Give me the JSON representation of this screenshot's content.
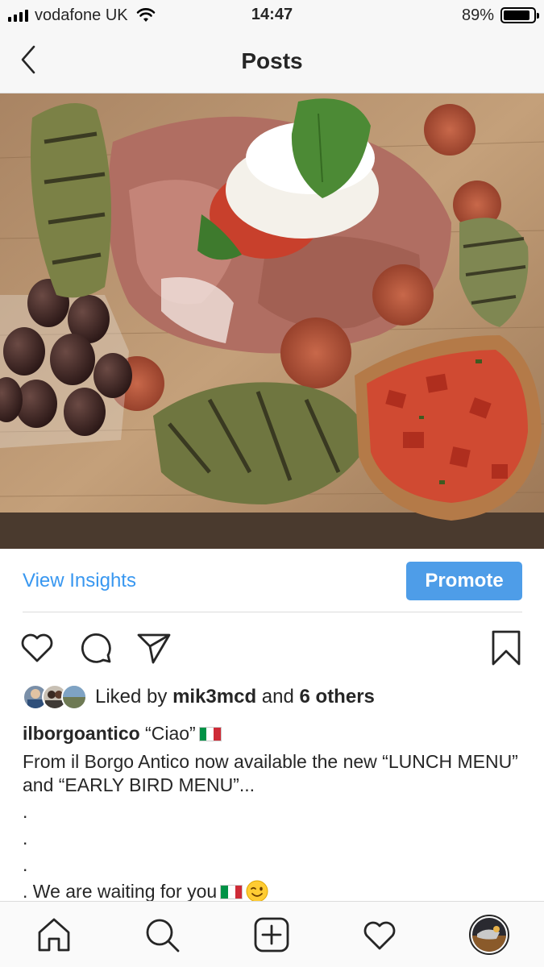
{
  "status_bar": {
    "carrier": "vodafone UK",
    "time": "14:47",
    "battery_percent": "89%",
    "battery_level": 0.89
  },
  "header": {
    "title": "Posts",
    "back_icon": "chevron-left-icon"
  },
  "photo": {
    "icon": "food-platter-photo"
  },
  "insights": {
    "view_insights_label": "View Insights",
    "promote_label": "Promote"
  },
  "actions": {
    "icons": [
      "heart-icon",
      "comment-icon",
      "share-icon",
      "bookmark-icon"
    ]
  },
  "likes": {
    "prefix": "Liked by ",
    "user": "mik3mcd",
    "middle": " and ",
    "others": "6 others"
  },
  "caption": {
    "username": "ilborgoantico",
    "title": " “Ciao”",
    "body": "From il Borgo Antico now available the new “LUNCH MENU” and “EARLY BIRD MENU”...",
    "dot1": ".",
    "dot2": ".",
    "dot3": ".",
    "closing": ". We are waiting for you"
  },
  "tabbar": {
    "icons": [
      "home-icon",
      "search-icon",
      "add-post-icon",
      "activity-heart-icon",
      "profile-avatar"
    ]
  },
  "colors": {
    "accent": "#3897f0",
    "promote_bg": "#4e9de8",
    "text": "#262626",
    "bar_bg": "#f7f7f7"
  }
}
